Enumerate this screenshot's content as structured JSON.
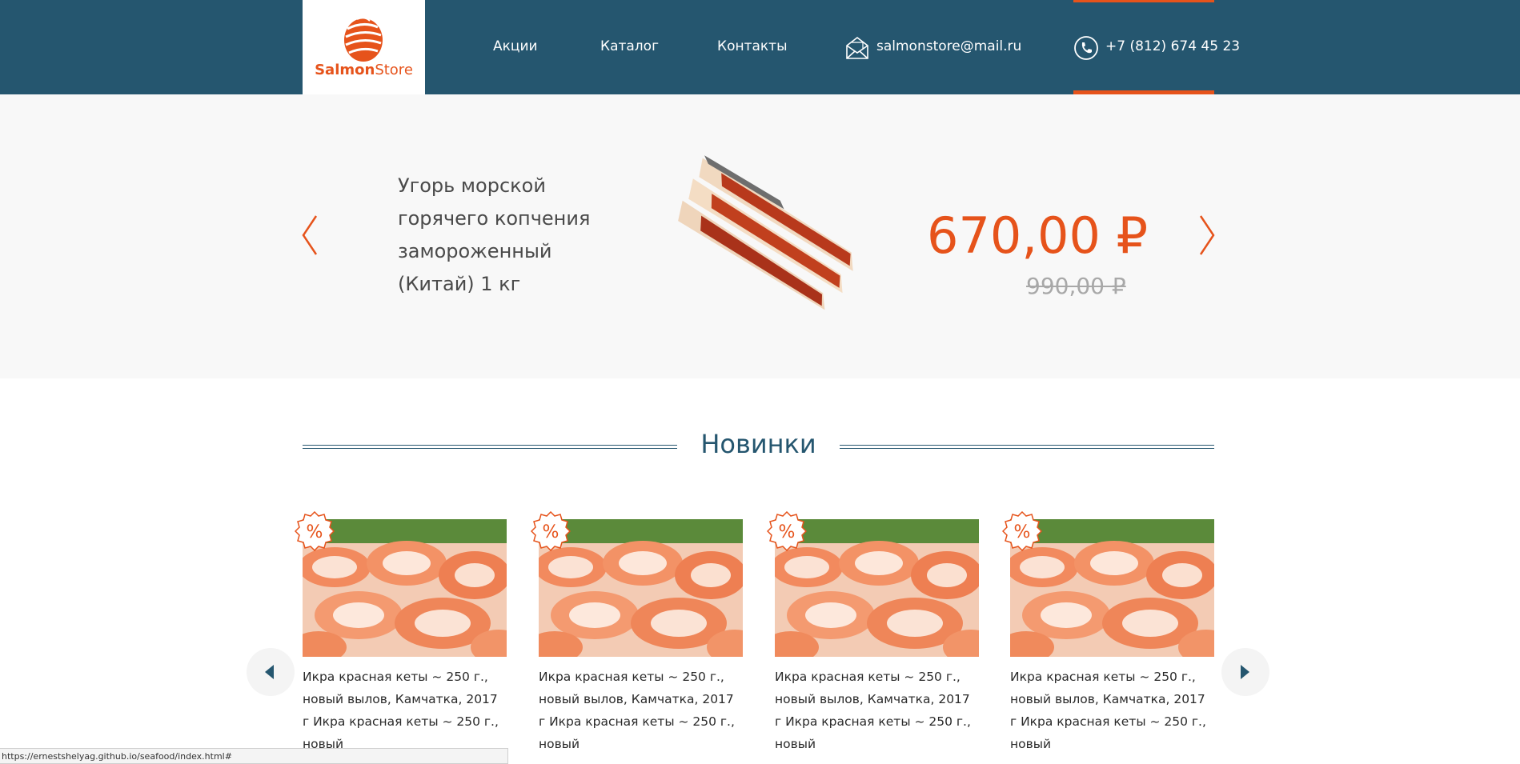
{
  "logo": {
    "brand_bold": "Salmon",
    "brand_light": "Store"
  },
  "nav": [
    {
      "label": "Акции"
    },
    {
      "label": "Каталог"
    },
    {
      "label": "Контакты"
    }
  ],
  "contacts": {
    "email": "salmonstore@mail.ru",
    "phone": "+7 (812) 674 45 23"
  },
  "banner": {
    "title": "Угорь морской горячего копчения замороженный (Китай) 1 кг",
    "price_new": "670,00 ₽",
    "price_old": "990,00 ₽"
  },
  "section": {
    "title": "Новинки"
  },
  "products": [
    {
      "badge": "%",
      "text": "Икра красная кеты ~ 250 г., новый вылов, Камчатка, 2017 г Икра красная кеты ~ 250 г., новый"
    },
    {
      "badge": "%",
      "text": "Икра красная кеты ~ 250 г., новый вылов, Камчатка, 2017 г Икра красная кеты ~ 250 г., новый"
    },
    {
      "badge": "%",
      "text": "Икра красная кеты ~ 250 г., новый вылов, Камчатка, 2017 г Икра красная кеты ~ 250 г., новый"
    },
    {
      "badge": "%",
      "text": "Икра красная кеты ~ 250 г., новый вылов, Камчатка, 2017 г Икра красная кеты ~ 250 г., новый"
    }
  ],
  "status_bar": {
    "url": "https://ernestshelyag.github.io/seafood/index.html#"
  },
  "colors": {
    "header_bg": "#25566f",
    "accent": "#e6531b",
    "banner_bg": "#f8f8f8"
  },
  "icons": [
    "salmon-logo-icon",
    "envelope-icon",
    "phone-icon",
    "chevron-left-icon",
    "chevron-right-icon",
    "percent-badge-icon",
    "triangle-left-icon",
    "triangle-right-icon"
  ]
}
